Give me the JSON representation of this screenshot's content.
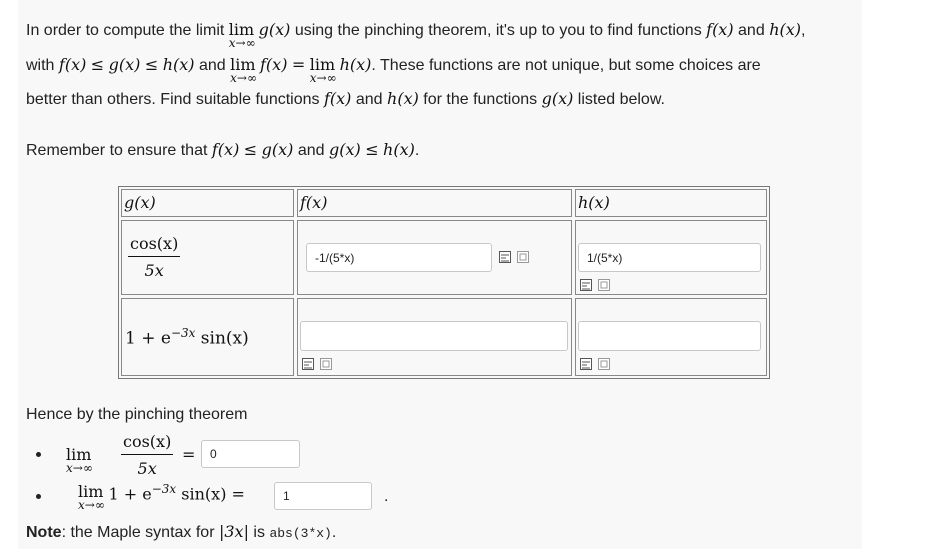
{
  "intro": {
    "p1_pre": "In order to compute the limit",
    "p1_mid": "using the pinching theorem, it's up to you to find functions",
    "p1_and": "and",
    "p2_with": "with",
    "p2_and": "and",
    "p2_post": ". These functions are not unique, but some choices are",
    "p3_pre": "better than others. Find suitable functions",
    "p3_and": "and",
    "p3_for": "for the functions",
    "p3_post": "listed below.",
    "remember_pre": "Remember to ensure that",
    "remember_and": "and",
    "remember_post": "."
  },
  "math": {
    "lim": "lim",
    "x_to_inf": "x→∞",
    "f": "f(x)",
    "g": "g(x)",
    "h": "h(x)",
    "le": "≤",
    "eq": "=",
    "cos": "cos(x)",
    "five_x": "5x",
    "one_plus": "1 + e",
    "exp": "−3x",
    "sin": " sin(x)",
    "abs3x": "|3x|"
  },
  "table": {
    "headers": [
      "g(x)",
      "f(x)",
      "h(x)"
    ],
    "rows": [
      {
        "f_value": "-1/(5*x)",
        "h_value": "1/(5*x)"
      },
      {
        "f_value": "",
        "h_value": ""
      }
    ]
  },
  "conclusion": {
    "heading": "Hence by the pinching theorem",
    "answer1": "0",
    "answer2": "1",
    "trailing_dot": "."
  },
  "note": {
    "label": "Note",
    "text_pre": ": the Maple syntax for",
    "text_is": "is",
    "code": "abs(3*x)",
    "text_post": "."
  }
}
